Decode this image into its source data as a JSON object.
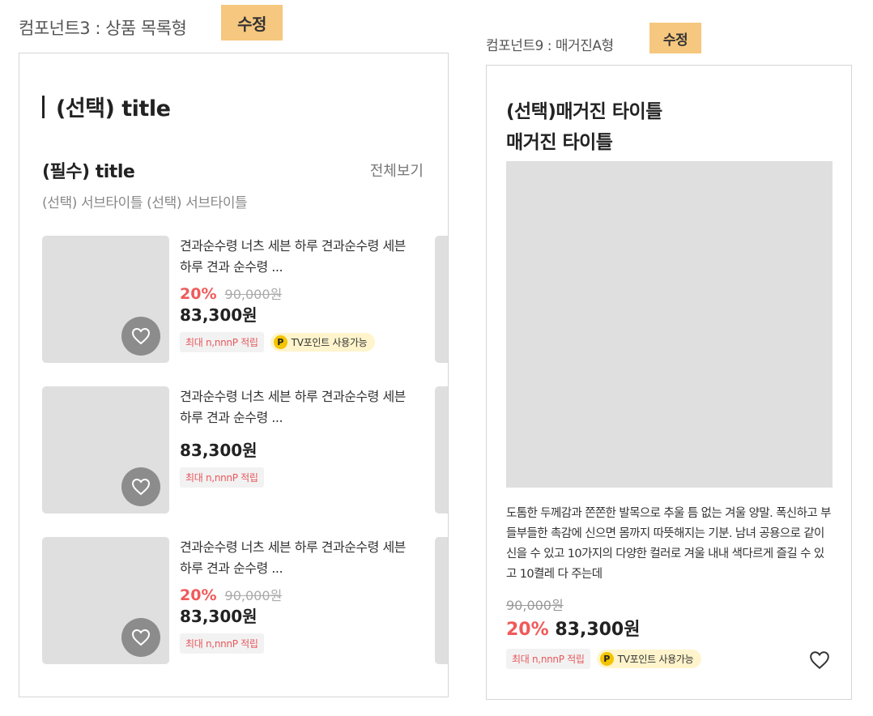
{
  "component3": {
    "label": "컴포넌트3 : 상품 목록형",
    "edit_label": "수정",
    "optional_title": "(선택) title",
    "required_title": "(필수) title",
    "view_all": "전체보기",
    "subtitle": "(선택) 서브타이틀 (선택) 서브타이틀",
    "items": [
      {
        "name": "견과순수령 너츠 세븐 하루 견과순수령 세븐 하루 견과 순수령 ...",
        "discount": "20%",
        "original_price": "90,000원",
        "price": "83,300원",
        "point_badge": "최대 n,nnnP 적립",
        "tv_badge": "TV포인트 사용가능",
        "p_icon": "P"
      },
      {
        "name": "견과순수령 너츠 세븐 하루 견과순수령 세븐 하루 견과 순수령 ...",
        "discount": "",
        "original_price": "",
        "price": "83,300원",
        "point_badge": "최대 n,nnnP 적립",
        "tv_badge": ""
      },
      {
        "name": "견과순수령 너츠 세븐 하루 견과순수령 세븐 하루 견과 순수령 ...",
        "discount": "20%",
        "original_price": "90,000원",
        "price": "83,300원",
        "point_badge": "최대 n,nnnP 적립",
        "tv_badge": ""
      }
    ]
  },
  "component9": {
    "label": "컴포넌트9 : 매거진A형",
    "edit_label": "수정",
    "title_line1": "(선택)매거진 타이틀",
    "title_line2": "매거진 타이틀",
    "description": "도톰한 두께감과 쫀쫀한 발목으로 추울 틈 없는 겨울 양말. 폭신하고 부들부들한 촉감에 신으면 몸까지 따뜻해지는 기분. 남녀 공용으로 같이 신을 수 있고 10가지의 다양한 컬러로 겨울 내내 색다르게 즐길 수 있고 10켤레 다 주는데",
    "original_price": "90,000원",
    "discount": "20%",
    "price": "83,300원",
    "point_badge": "최대 n,nnnP 적립",
    "tv_badge": "TV포인트 사용가능",
    "p_icon": "P"
  },
  "colors": {
    "accent_discount": "#f05a5a",
    "edit_button": "#f6c77e",
    "placeholder": "#dfdfe0",
    "tv_badge_bg": "#fff4cc"
  },
  "icons": [
    "heart-icon",
    "point-p-icon"
  ]
}
